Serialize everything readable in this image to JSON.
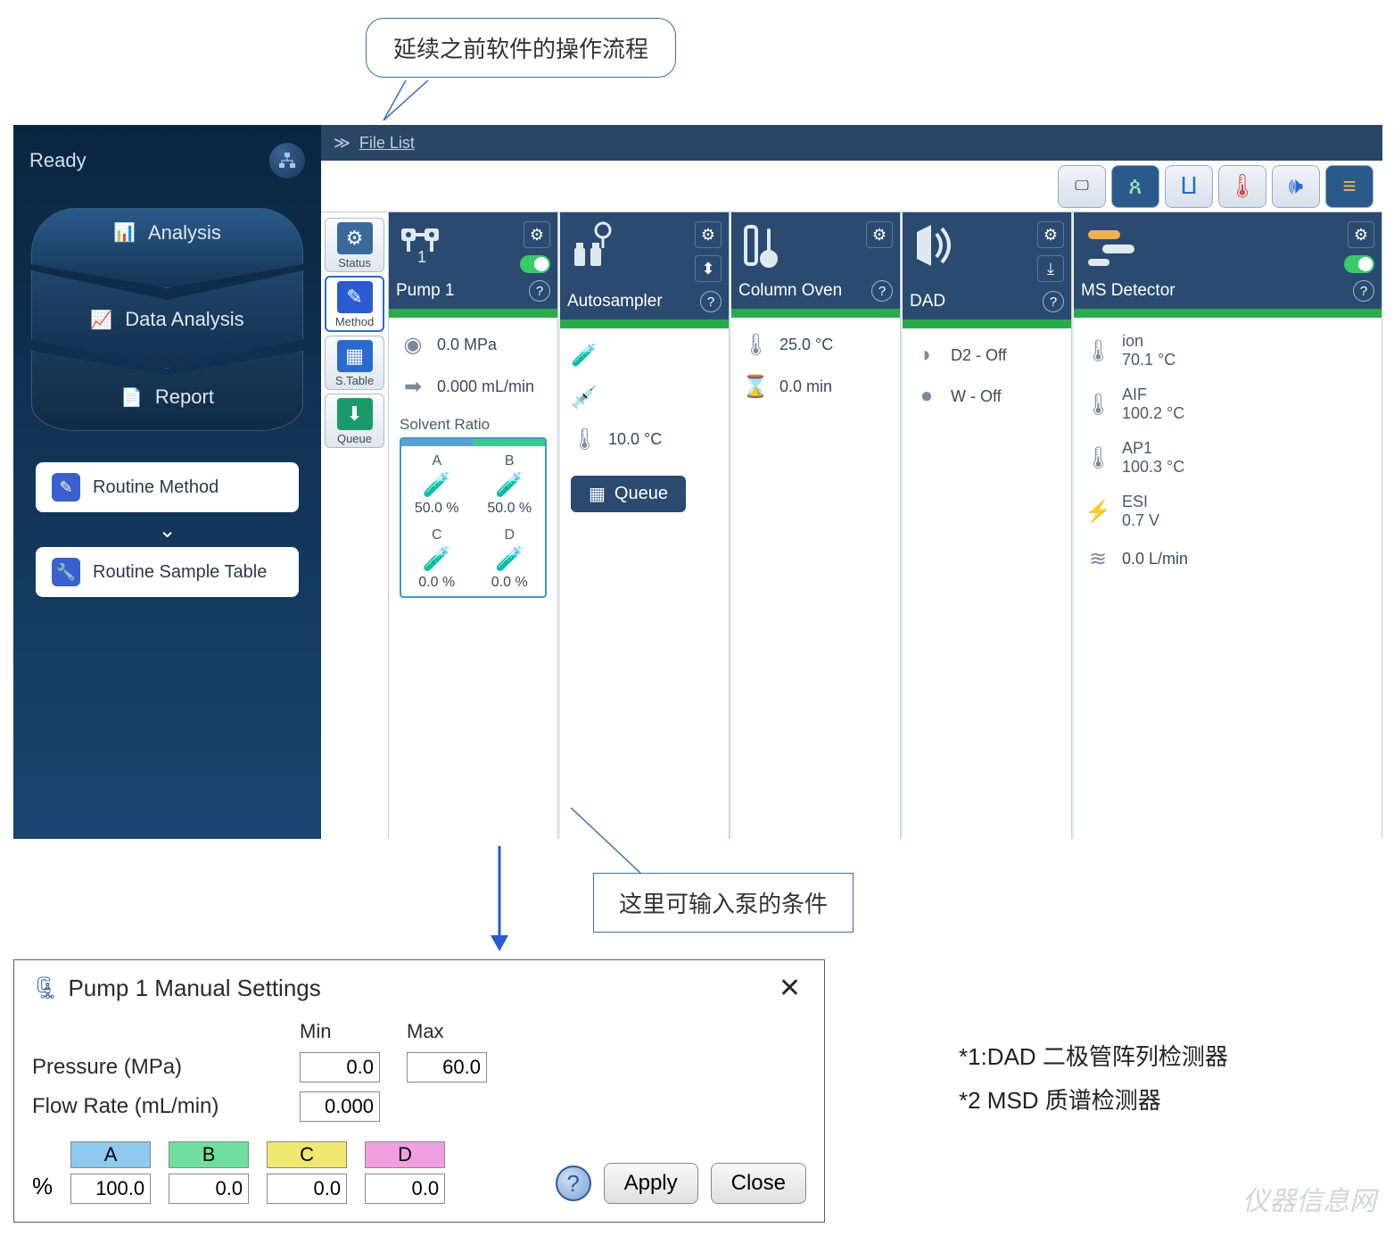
{
  "callouts": {
    "top": "延续之前软件的操作流程",
    "middle": "这里可输入泵的条件"
  },
  "sidebar": {
    "status": "Ready",
    "nav": {
      "analysis": "Analysis",
      "data_analysis": "Data Analysis",
      "report": "Report"
    },
    "routine_method": "Routine Method",
    "routine_sample_table": "Routine Sample Table"
  },
  "file_list": {
    "label": "File List"
  },
  "modules": {
    "status": "Status",
    "method": "Method",
    "stable": "S.Table",
    "queue": "Queue"
  },
  "cards": {
    "pump": {
      "title": "Pump 1",
      "pressure": "0.0 MPa",
      "flow": "0.000 mL/min",
      "solvent_label": "Solvent Ratio",
      "solvents": {
        "A": {
          "label": "A",
          "pct": "50.0 %",
          "color": "#5aa0d5"
        },
        "B": {
          "label": "B",
          "pct": "50.0 %",
          "color": "#3aca8a"
        },
        "C": {
          "label": "C",
          "pct": "0.0 %",
          "color": "#e0d060"
        },
        "D": {
          "label": "D",
          "pct": "0.0 %",
          "color": "#e090d0"
        }
      }
    },
    "autosampler": {
      "title": "Autosampler",
      "temp": "10.0 °C",
      "queue_btn": "Queue"
    },
    "oven": {
      "title": "Column Oven",
      "temp": "25.0 °C",
      "time": "0.0 min"
    },
    "dad": {
      "title": "DAD",
      "d2": "D2 - Off",
      "w": "W - Off"
    },
    "ms": {
      "title": "MS Detector",
      "ion": {
        "label": "ion",
        "val": "70.1 °C"
      },
      "aif": {
        "label": "AIF",
        "val": "100.2 °C"
      },
      "ap1": {
        "label": "AP1",
        "val": "100.3 °C"
      },
      "esi": {
        "label": "ESI",
        "val": "0.7 V"
      },
      "flow": "0.0 L/min"
    }
  },
  "dialog": {
    "title": "Pump 1 Manual Settings",
    "min_hdr": "Min",
    "max_hdr": "Max",
    "pressure_label": "Pressure (MPa)",
    "pressure_min": "0.0",
    "pressure_max": "60.0",
    "flow_label": "Flow Rate (mL/min)",
    "flow_val": "0.000",
    "pct_symbol": "%",
    "solvents": {
      "A": {
        "label": "A",
        "val": "100.0",
        "color": "#8ecaf0"
      },
      "B": {
        "label": "B",
        "val": "0.0",
        "color": "#70e0a0"
      },
      "C": {
        "label": "C",
        "val": "0.0",
        "color": "#f0e870"
      },
      "D": {
        "label": "D",
        "val": "0.0",
        "color": "#f0a0e0"
      }
    },
    "apply": "Apply",
    "close": "Close"
  },
  "footnotes": {
    "l1": "*1:DAD 二极管阵列检测器",
    "l2": "*2 MSD 质谱检测器"
  },
  "watermark": "仪器信息网"
}
